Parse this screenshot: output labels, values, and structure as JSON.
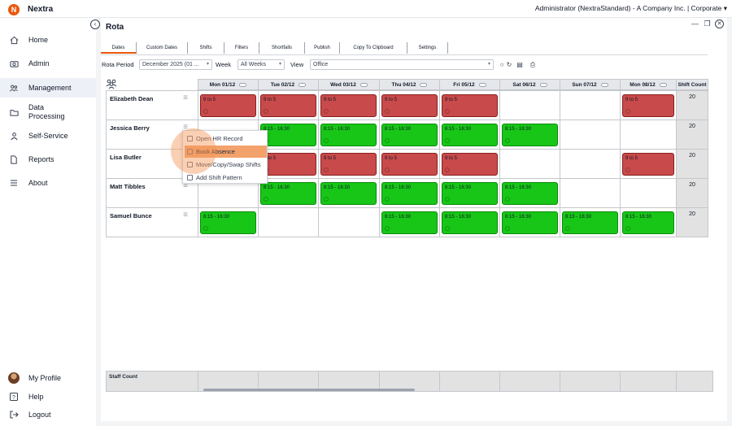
{
  "app": {
    "brand": "Nextra",
    "account": "Administrator (NextraStandard) - A Company Inc. | Corporate"
  },
  "sidebar": {
    "items": [
      {
        "label": "Home",
        "icon": "home-icon"
      },
      {
        "label": "Admin",
        "icon": "camera-icon"
      },
      {
        "label": "Management",
        "icon": "people-icon",
        "active": true
      },
      {
        "label": "Data Processing",
        "icon": "folder-icon"
      },
      {
        "label": "Self-Service",
        "icon": "person-icon"
      },
      {
        "label": "Reports",
        "icon": "document-icon"
      },
      {
        "label": "About",
        "icon": "menu-icon"
      }
    ],
    "bottom": [
      {
        "label": "My Profile",
        "icon": "avatar"
      },
      {
        "label": "Help",
        "icon": "help-icon"
      },
      {
        "label": "Logout",
        "icon": "logout-icon"
      }
    ]
  },
  "page": {
    "title": "Rota"
  },
  "tabs": [
    "Dates",
    "Custom Dates",
    "Shifts",
    "Filters",
    "Shortfalls",
    "Publish",
    "Copy To Clipboard",
    "Settings"
  ],
  "filters": {
    "rota_period_label": "Rota Period",
    "rota_period_value": "December 2025 (01 ...",
    "week_label": "Week",
    "week_value": "All Weeks",
    "view_label": "View",
    "view_value": "Office"
  },
  "grid": {
    "days": [
      "Mon 01/12",
      "Tue 02/12",
      "Wed 03/12",
      "Thu 04/12",
      "Fri 05/12",
      "Sat 06/12",
      "Sun 07/12",
      "Mon 08/12"
    ],
    "shift_count_label": "Shift Count",
    "staff_count_label": "Staff Count",
    "rows": [
      {
        "name": "Elizabeth Dean",
        "count": "20",
        "shifts": [
          "9 to 5",
          "9 to 5",
          "9 to 5",
          "9 to 5",
          "9 to 5",
          "",
          "",
          "9 to 5"
        ]
      },
      {
        "name": "Jessica Berry",
        "count": "20",
        "shifts": [
          "",
          "8:15 - 16:30",
          "8:15 - 16:30",
          "8:15 - 16:30",
          "8:15 - 16:30",
          "8:15 - 16:30",
          "",
          ""
        ]
      },
      {
        "name": "Lisa Butler",
        "count": "20",
        "shifts": [
          "",
          "9 to 5",
          "9 to 5",
          "9 to 5",
          "9 to 5",
          "",
          "",
          "9 to 5"
        ]
      },
      {
        "name": "Matt Tibbles",
        "count": "20",
        "shifts": [
          "",
          "8:15 - 16:30",
          "8:15 - 16:30",
          "8:15 - 16:30",
          "8:15 - 16:30",
          "8:15 - 16:30",
          "",
          ""
        ]
      },
      {
        "name": "Samuel Bunce",
        "count": "20",
        "shifts": [
          "8:15 - 16:30",
          "",
          "",
          "8:15 - 16:30",
          "8:15 - 16:30",
          "8:15 - 16:30",
          "8:15 - 16:30",
          "8:15 - 16:30"
        ]
      }
    ]
  },
  "context_menu": {
    "items": [
      "Open HR Record",
      "Book Absence",
      "Move/Copy/Swap Shifts",
      "Add Shift Pattern"
    ],
    "highlighted": 1
  },
  "colors": {
    "accent": "#ea580c",
    "absence": "#c84a4a",
    "work": "#17c617"
  }
}
